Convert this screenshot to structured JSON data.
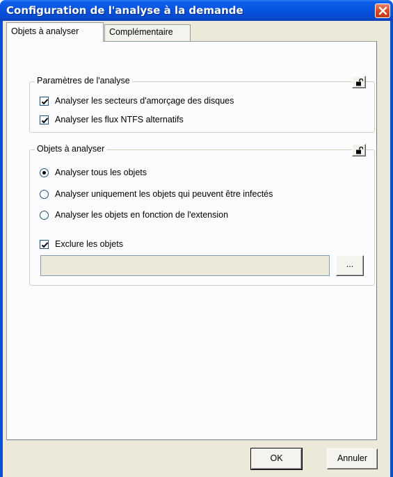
{
  "window": {
    "title": "Configuration de l'analyse à la demande"
  },
  "tabs": [
    {
      "label": "Objets à analyser",
      "active": true
    },
    {
      "label": "Complémentaire",
      "active": false
    }
  ],
  "group_params": {
    "title": "Paramètres de l'analyse",
    "options": [
      {
        "label": "Analyser les secteurs d'amorçage des disques",
        "checked": true
      },
      {
        "label": "Analyser les flux NTFS alternatifs",
        "checked": true
      }
    ]
  },
  "group_objects": {
    "title": "Objets à analyser",
    "radios": [
      {
        "label": "Analyser tous les objets",
        "selected": true
      },
      {
        "label": "Analyser uniquement les objets qui peuvent être infectés",
        "selected": false
      },
      {
        "label": "Analyser les objets en fonction de l'extension",
        "selected": false
      }
    ],
    "exclude": {
      "label": "Exclure les objets",
      "checked": true,
      "value": ""
    },
    "browse_label": "..."
  },
  "buttons": {
    "ok": "OK",
    "cancel": "Annuler"
  },
  "colors": {
    "titlebar": "#0553df",
    "face": "#ece9d8",
    "close": "#d6461f"
  }
}
